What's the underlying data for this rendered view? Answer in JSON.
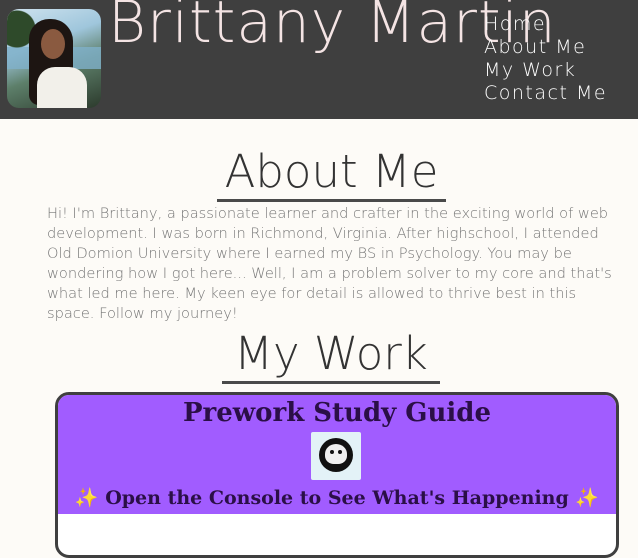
{
  "header": {
    "name": "Brittany Martin",
    "nav": [
      "Home",
      "About Me",
      "My Work",
      "Contact Me"
    ]
  },
  "about": {
    "title": "About Me",
    "body": "Hi! I'm Brittany, a passionate learner and crafter in the exciting world of web development. I was born in Richmond, Virginia. After highschool, I attended Old Domion University where I earned my BS in Psychology. You may be wondering how I got here... Well, I am a problem solver to my core and that's what led me here. My keen eye for detail is allowed to thrive best in this space. Follow my journey!"
  },
  "work": {
    "title": "My Work",
    "card": {
      "title": "Prework Study Guide",
      "logo_icon": "github-cat-icon",
      "subtitle_sparkle": "✨",
      "subtitle": "Open the Console to See What's Happening"
    }
  },
  "colors": {
    "header_bg": "#3f3f3f",
    "page_bg": "#fdfbf7",
    "card_accent": "#a15cff",
    "card_text": "#2b0f47"
  }
}
